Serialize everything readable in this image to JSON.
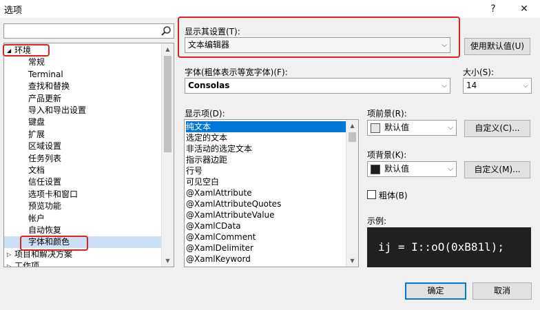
{
  "window": {
    "title": "选项",
    "help": "?",
    "close": "✕"
  },
  "search": {
    "value": "",
    "placeholder": ""
  },
  "tree": {
    "items": [
      {
        "label": "环境",
        "level": 0,
        "expanded": true
      },
      {
        "label": "常规",
        "level": 1
      },
      {
        "label": "Terminal",
        "level": 1
      },
      {
        "label": "查找和替换",
        "level": 1
      },
      {
        "label": "产品更新",
        "level": 1
      },
      {
        "label": "导入和导出设置",
        "level": 1
      },
      {
        "label": "键盘",
        "level": 1
      },
      {
        "label": "扩展",
        "level": 1
      },
      {
        "label": "区域设置",
        "level": 1
      },
      {
        "label": "任务列表",
        "level": 1
      },
      {
        "label": "文档",
        "level": 1
      },
      {
        "label": "信任设置",
        "level": 1
      },
      {
        "label": "选项卡和窗口",
        "level": 1
      },
      {
        "label": "预览功能",
        "level": 1
      },
      {
        "label": "帐户",
        "level": 1
      },
      {
        "label": "自动恢复",
        "level": 1
      },
      {
        "label": "字体和颜色",
        "level": 1,
        "selected": true
      },
      {
        "label": "项目和解决方案",
        "level": 0,
        "expanded": false
      },
      {
        "label": "工作项",
        "level": 0,
        "expanded": false
      }
    ]
  },
  "show_settings": {
    "label": "显示其设置(T):",
    "value": "文本编辑器"
  },
  "use_defaults": {
    "label": "使用默认值(U)"
  },
  "font": {
    "label": "字体(粗体表示等宽字体)(F):",
    "value": "Consolas"
  },
  "size": {
    "label": "大小(S):",
    "value": "14"
  },
  "display_items": {
    "label": "显示项(D):",
    "items": [
      "纯文本",
      "选定的文本",
      "非活动的选定文本",
      "指示器边距",
      "行号",
      "可见空白",
      "@XamlAttribute",
      "@XamlAttributeQuotes",
      "@XamlAttributeValue",
      "@XamlCData",
      "@XamlComment",
      "@XamlDelimiter",
      "@XamlKeyword"
    ],
    "selected_index": 0
  },
  "foreground": {
    "label": "项前景(R):",
    "value": "默认值",
    "color": "#e6e6e6",
    "custom_label": "自定义(C)..."
  },
  "background": {
    "label": "项背景(K):",
    "value": "默认值",
    "color": "#1e1e1e",
    "custom_label": "自定义(M)..."
  },
  "bold": {
    "label": "粗体(B)",
    "checked": false
  },
  "sample": {
    "label": "示例:",
    "text": "ij = I::oO(0xB81l);"
  },
  "footer": {
    "ok": "确定",
    "cancel": "取消"
  },
  "colors": {
    "selection": "#0078d7",
    "tree_selection": "#cce0f5",
    "highlight": "#e02020"
  }
}
